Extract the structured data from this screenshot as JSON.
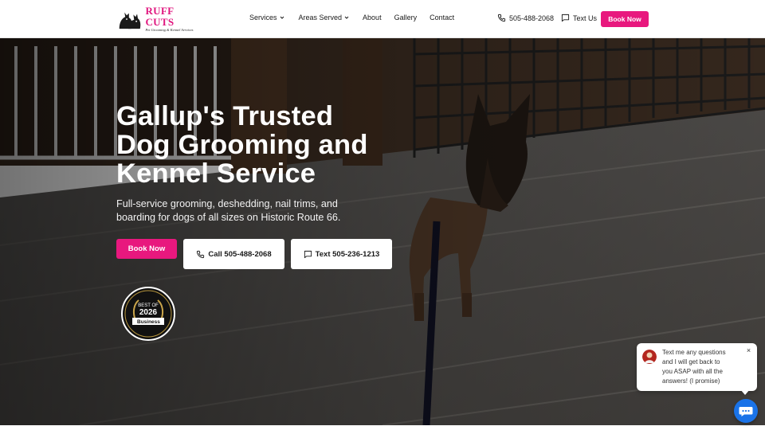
{
  "brand": {
    "name": "RUFF CUTS",
    "tagline": "Pet Grooming & Kennel Services",
    "logo_icon": "dog-cat-silhouette-logo"
  },
  "nav": {
    "items": [
      {
        "label": "Services",
        "has_dropdown": true
      },
      {
        "label": "Areas Served",
        "has_dropdown": true
      },
      {
        "label": "About",
        "has_dropdown": false
      },
      {
        "label": "Gallery",
        "has_dropdown": false
      },
      {
        "label": "Contact",
        "has_dropdown": false
      }
    ],
    "phone": "505-488-2068",
    "text_label": "Text Us",
    "book_label": "Book Now"
  },
  "hero": {
    "headline_lines": [
      "Gallup's Trusted",
      "Dog Grooming and",
      "Kennel Service"
    ],
    "subline_lines": [
      "Full-service grooming, deshedding, nail trims, and",
      "boarding for dogs of all sizes on Historic Route 66."
    ],
    "book_label": "Book Now",
    "call_label": "Call 505-488-2068",
    "text_label": "Text 505-236-1213",
    "badge": {
      "line1": "BEST OF",
      "year": "2026",
      "source": "Business"
    }
  },
  "chat": {
    "message_lines": [
      "Text me any questions",
      "and I will get back to",
      "you ASAP with all the",
      "answers! (I promise)"
    ],
    "close_symbol": "×",
    "launcher_icon": "chat-bubble-icon"
  },
  "colors": {
    "accent": "#e8187e",
    "chat_blue": "#1a73e8",
    "text_dark": "#1a1a1a"
  }
}
